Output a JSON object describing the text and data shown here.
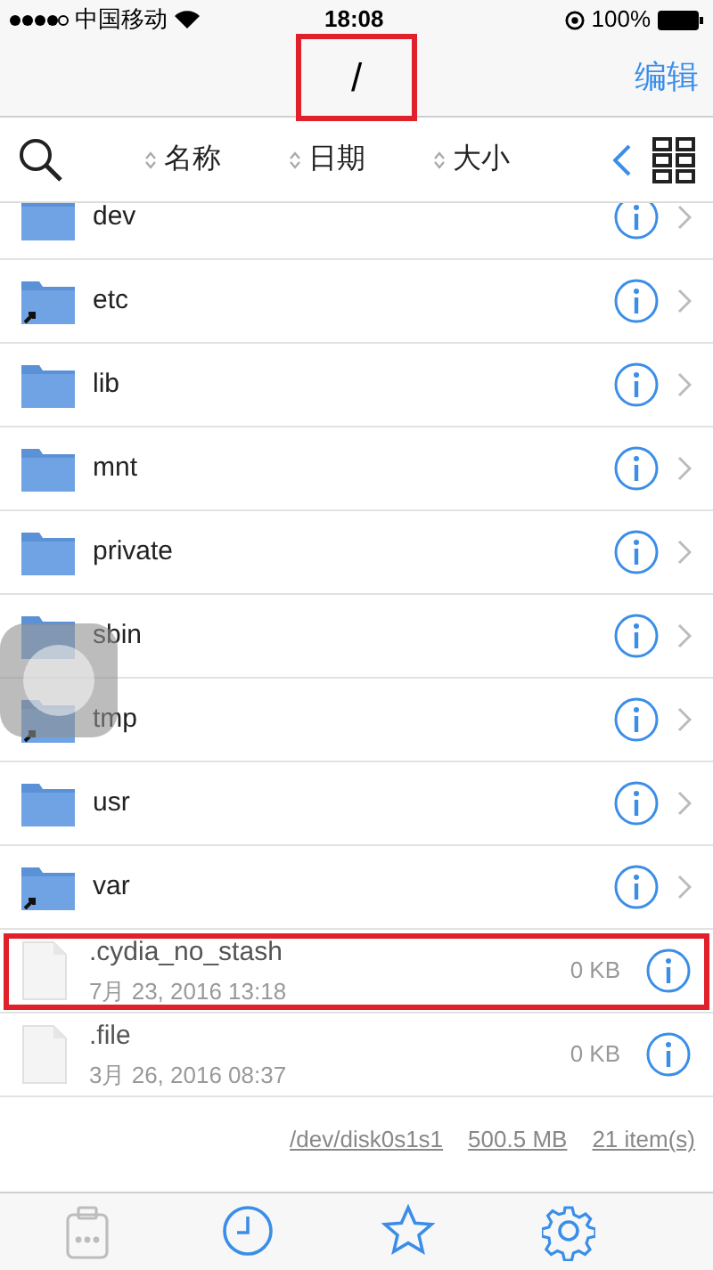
{
  "status_bar": {
    "carrier": "中国移动",
    "time": "18:08",
    "battery": "100%"
  },
  "nav": {
    "title": "/",
    "title_highlighted": true,
    "edit": "编辑"
  },
  "sort_bar": {
    "columns": [
      "名称",
      "日期",
      "大小"
    ]
  },
  "items": [
    {
      "kind": "folder",
      "name": "dev",
      "alias": false,
      "highlighted": false
    },
    {
      "kind": "folder",
      "name": "etc",
      "alias": true,
      "highlighted": false
    },
    {
      "kind": "folder",
      "name": "lib",
      "alias": false,
      "highlighted": false
    },
    {
      "kind": "folder",
      "name": "mnt",
      "alias": false,
      "highlighted": false
    },
    {
      "kind": "folder",
      "name": "private",
      "alias": false,
      "highlighted": false
    },
    {
      "kind": "folder",
      "name": "sbin",
      "alias": false,
      "highlighted": false
    },
    {
      "kind": "folder",
      "name": "tmp",
      "alias": true,
      "highlighted": false
    },
    {
      "kind": "folder",
      "name": "usr",
      "alias": false,
      "highlighted": false
    },
    {
      "kind": "folder",
      "name": "var",
      "alias": true,
      "highlighted": false
    },
    {
      "kind": "file",
      "name": ".cydia_no_stash",
      "date": "7月 23, 2016 13:18",
      "size": "0 KB",
      "highlighted": true
    },
    {
      "kind": "file",
      "name": ".file",
      "date": "3月 26, 2016 08:37",
      "size": "0 KB",
      "highlighted": false
    }
  ],
  "footer": {
    "device": "/dev/disk0s1s1",
    "capacity": "500.5 MB",
    "count": "21 item(s)"
  },
  "tab_bar": [
    {
      "kind": "clipboard",
      "disabled": true
    },
    {
      "kind": "clock",
      "disabled": false
    },
    {
      "kind": "star",
      "disabled": false
    },
    {
      "kind": "gear",
      "disabled": false
    }
  ]
}
